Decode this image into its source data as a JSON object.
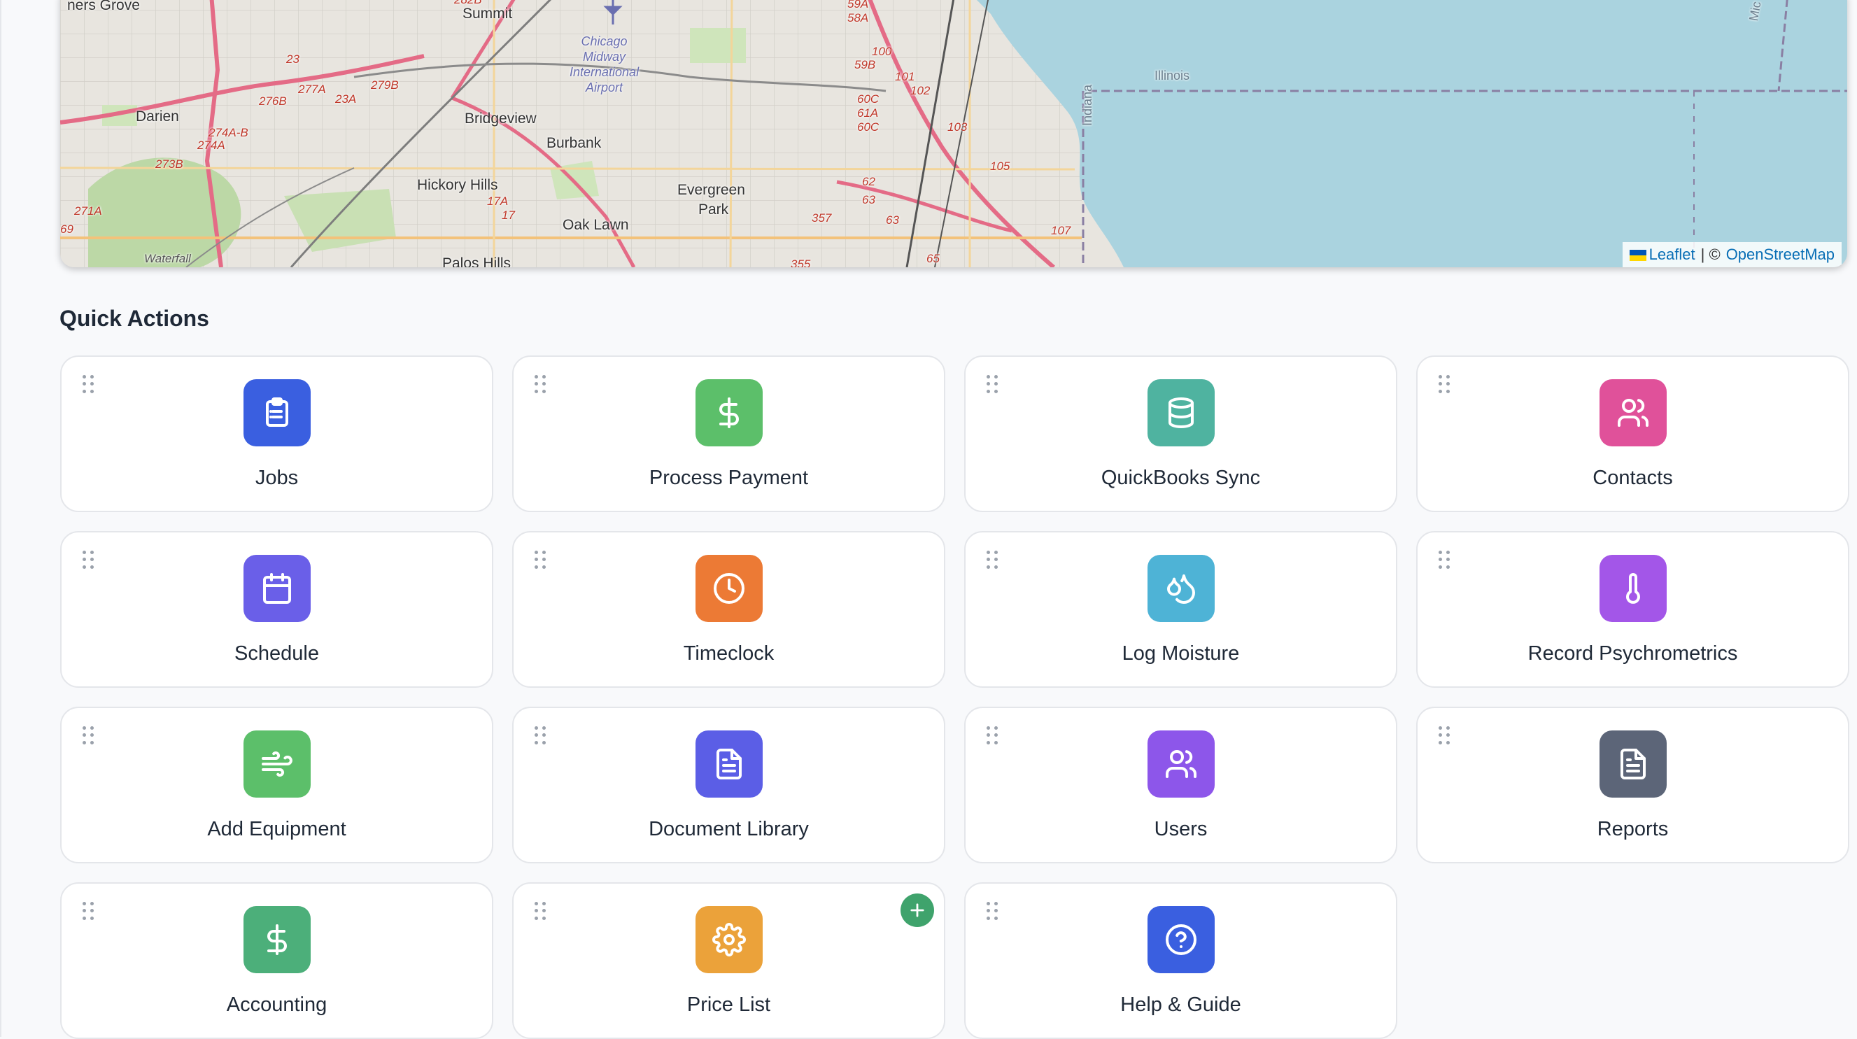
{
  "map": {
    "attribution": {
      "leaflet": "Leaflet",
      "separator": "| ©",
      "osm": "OpenStreetMap"
    },
    "places": [
      "ners Grove",
      "Summit",
      "Darien",
      "Bridgeview",
      "Burbank",
      "Hickory Hills",
      "Evergreen",
      "Park",
      "Oak Lawn",
      "Palos Hills",
      "Waterfall",
      "Illinois",
      "Indiana",
      "Mic"
    ],
    "airport": [
      "Chicago",
      "Midway",
      "International",
      "Airport"
    ],
    "routes": [
      "282B",
      "59A",
      "58A",
      "100",
      "59B",
      "101",
      "102",
      "23",
      "277A",
      "279B",
      "276B",
      "23A",
      "274A-B",
      "274A",
      "273B",
      "60C",
      "61A",
      "60C",
      "103",
      "105",
      "62",
      "63",
      "63",
      "357",
      "17A",
      "17",
      "271A",
      "69",
      "107",
      "65",
      "355"
    ]
  },
  "quick_actions": {
    "title": "Quick Actions",
    "items": [
      {
        "label": "Jobs",
        "color": "#3a5fe0",
        "icon": "clipboard-icon"
      },
      {
        "label": "Process Payment",
        "color": "#5cbf6a",
        "icon": "dollar-icon"
      },
      {
        "label": "QuickBooks Sync",
        "color": "#4fb3a0",
        "icon": "database-icon"
      },
      {
        "label": "Contacts",
        "color": "#e0519a",
        "icon": "users-icon"
      },
      {
        "label": "Schedule",
        "color": "#6a5fe8",
        "icon": "calendar-icon"
      },
      {
        "label": "Timeclock",
        "color": "#ec7a35",
        "icon": "clock-icon"
      },
      {
        "label": "Log Moisture",
        "color": "#4eb3d6",
        "icon": "droplets-icon"
      },
      {
        "label": "Record Psychrometrics",
        "color": "#a356e8",
        "icon": "thermometer-icon"
      },
      {
        "label": "Add Equipment",
        "color": "#5cbf6a",
        "icon": "wind-icon"
      },
      {
        "label": "Document Library",
        "color": "#5b5ee6",
        "icon": "document-icon"
      },
      {
        "label": "Users",
        "color": "#8d56ea",
        "icon": "users-icon"
      },
      {
        "label": "Reports",
        "color": "#5c6578",
        "icon": "document-icon"
      },
      {
        "label": "Accounting",
        "color": "#4caf7a",
        "icon": "dollar-icon"
      },
      {
        "label": "Price List",
        "color": "#eba23a",
        "icon": "gear-icon"
      },
      {
        "label": "Help & Guide",
        "color": "#3a5fe0",
        "icon": "help-circle-icon"
      }
    ],
    "add_badge_color": "#3fa36c"
  }
}
